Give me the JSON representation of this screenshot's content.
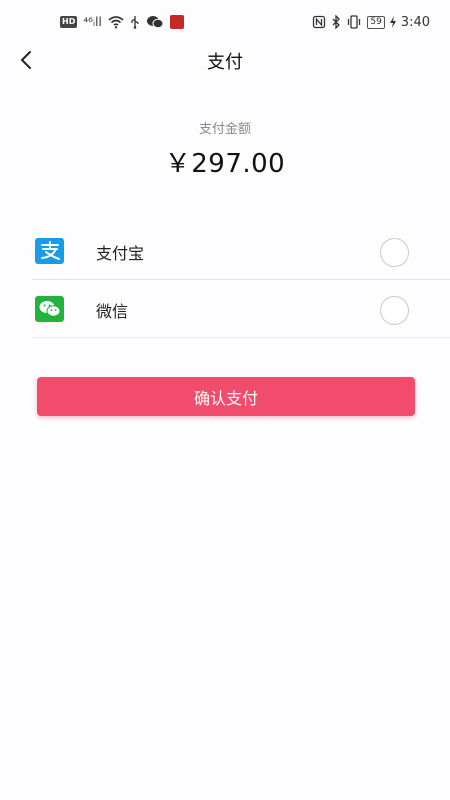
{
  "status_bar": {
    "hd_badge": "HD",
    "signal": "⁴⁶ᵢll",
    "battery": "59",
    "time": "3:40"
  },
  "header": {
    "title": "支付"
  },
  "amount": {
    "label": "支付金额",
    "value": "￥297.00"
  },
  "payment_methods": [
    {
      "label": "支付宝",
      "icon": "alipay-icon",
      "selected": false
    },
    {
      "label": "微信",
      "icon": "wechat-icon",
      "selected": false
    }
  ],
  "confirm_button": {
    "label": "确认支付"
  },
  "colors": {
    "accent": "#f14c6c",
    "alipay": "#1a9be8",
    "wechat": "#24b23f"
  }
}
